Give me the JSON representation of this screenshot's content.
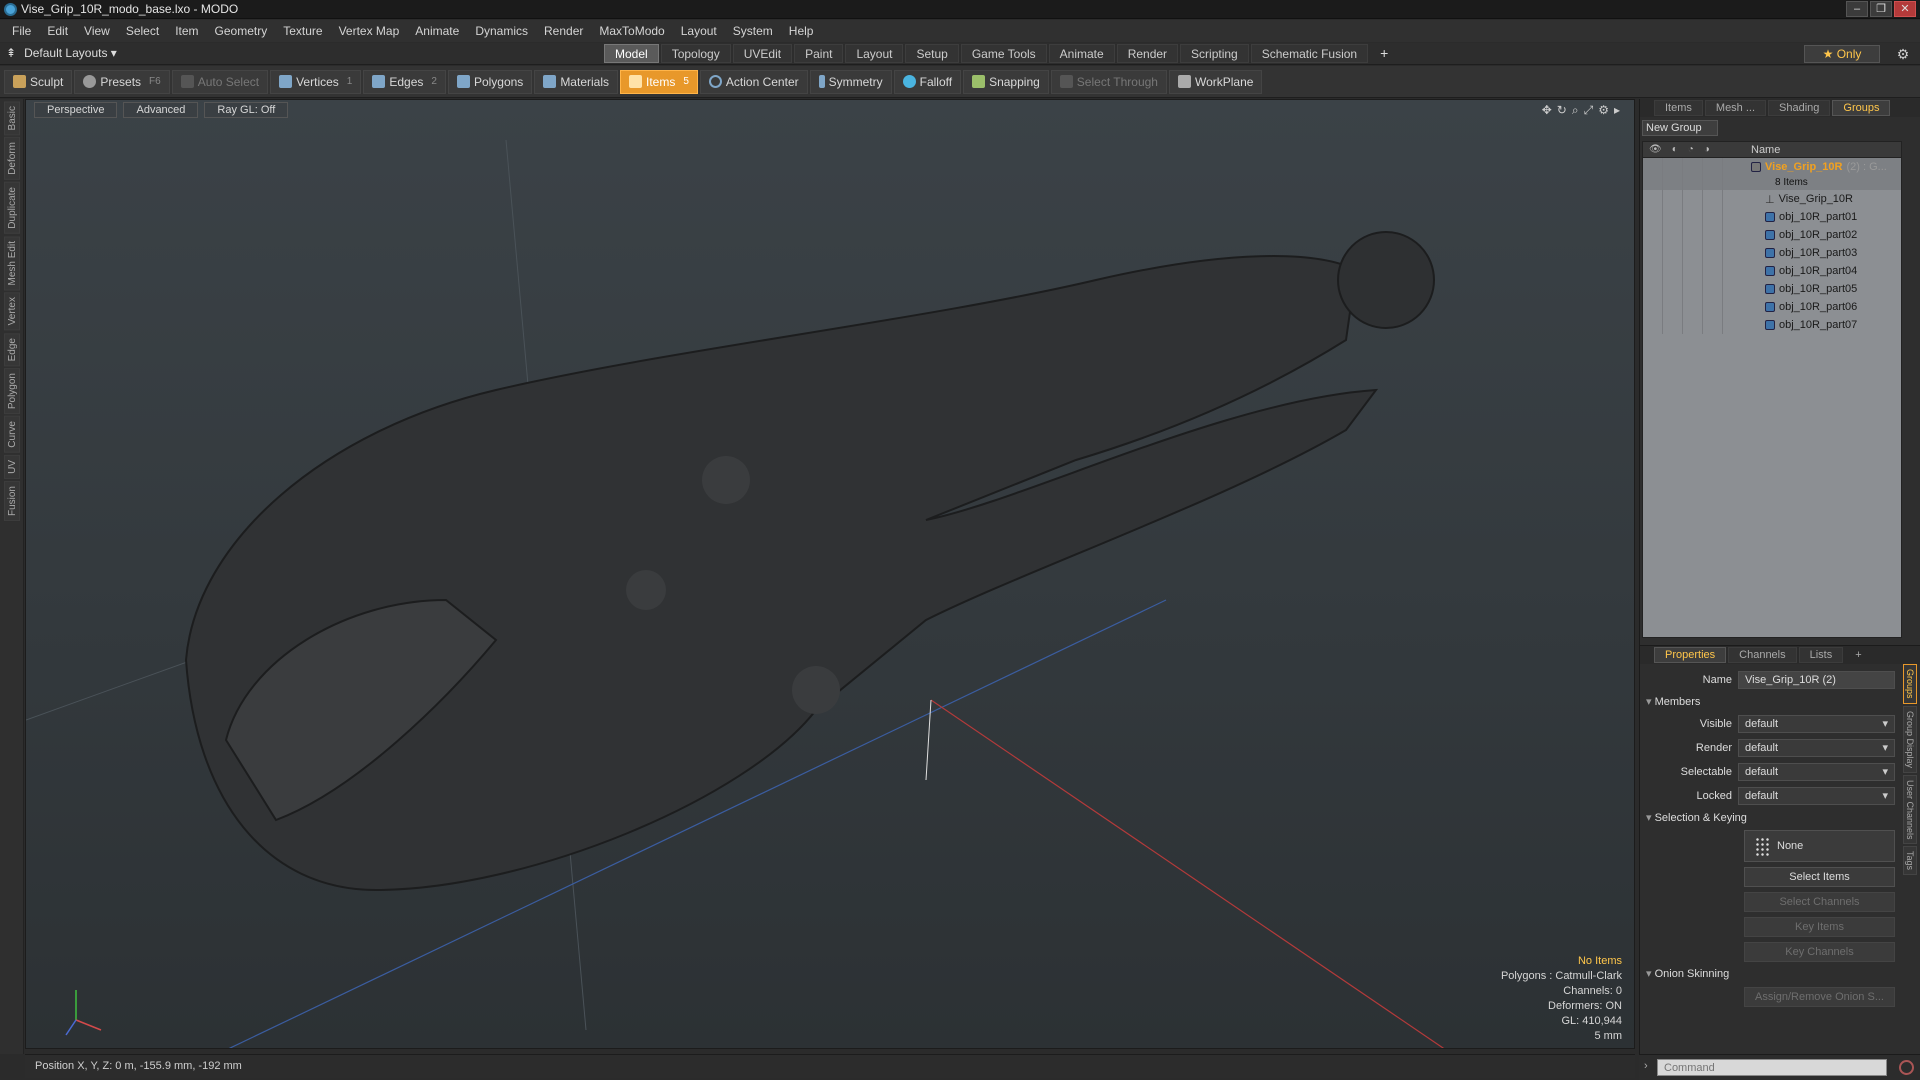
{
  "window": {
    "title": "Vise_Grip_10R_modo_base.lxo - MODO",
    "min": "–",
    "max": "❐",
    "close": "✕"
  },
  "menu": [
    "File",
    "Edit",
    "View",
    "Select",
    "Item",
    "Geometry",
    "Texture",
    "Vertex Map",
    "Animate",
    "Dynamics",
    "Render",
    "MaxToModo",
    "Layout",
    "System",
    "Help"
  ],
  "layouts": {
    "label": "Default Layouts"
  },
  "mode_tabs": [
    "Model",
    "Topology",
    "UVEdit",
    "Paint",
    "Layout",
    "Setup",
    "Game Tools",
    "Animate",
    "Render",
    "Scripting",
    "Schematic Fusion"
  ],
  "mode_active": "Model",
  "only_label": "★ Only",
  "toolbar": {
    "sculpt": "Sculpt",
    "presets": "Presets",
    "presets_key": "F6",
    "auto_select": "Auto Select",
    "vertices": "Vertices",
    "vertices_key": "1",
    "edges": "Edges",
    "edges_key": "2",
    "polygons": "Polygons",
    "materials": "Materials",
    "items": "Items",
    "items_key": "5",
    "action_center": "Action Center",
    "symmetry": "Symmetry",
    "falloff": "Falloff",
    "snapping": "Snapping",
    "select_through": "Select Through",
    "workplane": "WorkPlane"
  },
  "left_tabs": [
    "Basic",
    "Deform",
    "Duplicate",
    "Mesh Edit",
    "Vertex",
    "Edge",
    "Polygon",
    "Curve",
    "UV",
    "Fusion"
  ],
  "viewport": {
    "perspective": "Perspective",
    "advanced": "Advanced",
    "raygl": "Ray GL: Off",
    "info": {
      "no_items": "No Items",
      "polygons": "Polygons : Catmull-Clark",
      "channels": "Channels: 0",
      "deformers": "Deformers: ON",
      "gl": "GL: 410,944",
      "scale": "5 mm"
    }
  },
  "status": {
    "position": "Position X, Y, Z:  0 m, -155.9 mm, -192 mm"
  },
  "top_panel": {
    "tabs": [
      "Items",
      "Mesh ...",
      "Shading",
      "Groups"
    ],
    "active_tab": "Groups",
    "new_group": "New Group",
    "name_col": "Name",
    "group": {
      "name": "Vise_Grip_10R",
      "suffix": "(2) : G...",
      "count": "8 Items"
    },
    "items": [
      "Vise_Grip_10R",
      "obj_10R_part01",
      "obj_10R_part02",
      "obj_10R_part03",
      "obj_10R_part04",
      "obj_10R_part05",
      "obj_10R_part06",
      "obj_10R_part07"
    ]
  },
  "properties": {
    "tabs": [
      "Properties",
      "Channels",
      "Lists"
    ],
    "add": "+",
    "name_label": "Name",
    "name_value": "Vise_Grip_10R (2)",
    "members": "Members",
    "visible_label": "Visible",
    "visible_value": "default",
    "render_label": "Render",
    "render_value": "default",
    "selectable_label": "Selectable",
    "selectable_value": "default",
    "locked_label": "Locked",
    "locked_value": "default",
    "selection_keying": "Selection & Keying",
    "none": "None",
    "select_items": "Select Items",
    "select_channels": "Select Channels",
    "key_items": "Key Items",
    "key_channels": "Key Channels",
    "onion": "Onion Skinning",
    "assign_onion": "Assign/Remove Onion S...",
    "vtabs": [
      "Groups",
      "Group Display",
      "User Channels",
      "Tags"
    ]
  },
  "command": {
    "placeholder": "Command"
  }
}
